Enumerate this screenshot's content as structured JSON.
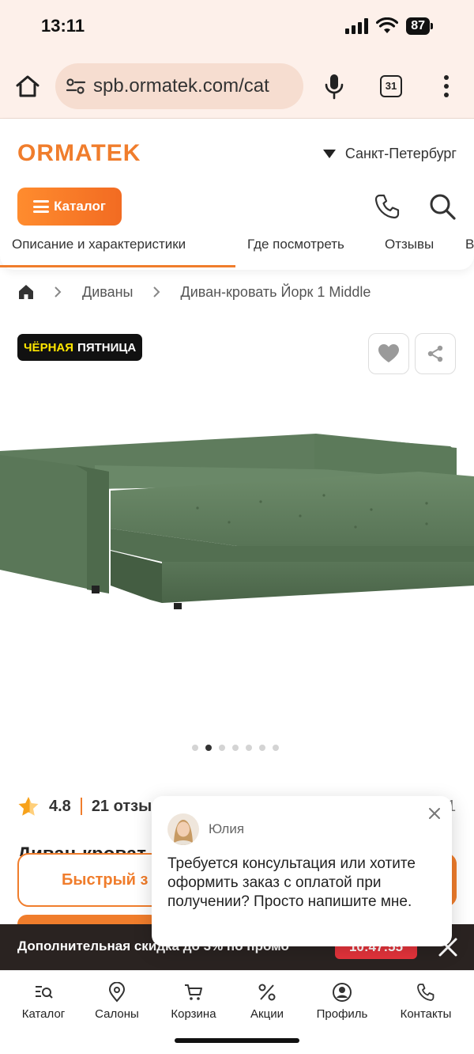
{
  "status_bar": {
    "time": "13:11",
    "battery": "87"
  },
  "browser": {
    "url": "spb.ormatek.com/cat",
    "tab_count": "31"
  },
  "header": {
    "logo": "ORMATEK",
    "city": "Санкт-Петербург",
    "catalog_label": "Каталог",
    "tabs": [
      {
        "label": "Описание и характеристики",
        "active": true
      },
      {
        "label": "Где посмотреть"
      },
      {
        "label": "Отзывы"
      },
      {
        "label": "В"
      }
    ]
  },
  "breadcrumb": {
    "items": [
      "Диваны",
      "Диван-кровать Йорк 1 Middle"
    ]
  },
  "badge": {
    "part1": "ЧЁРНАЯ",
    "part2": "ПЯТНИЦА"
  },
  "carousel": {
    "count": 7,
    "active": 1
  },
  "rating": {
    "value": "4.8",
    "reviews": "21 отзы",
    "extra": "1"
  },
  "product": {
    "title_peek": "Диван-кроват",
    "quick_buy_label": "Быстрый з"
  },
  "promo": {
    "text": "Дополнительная скидка до 3% по промо",
    "timer": "10:47:55"
  },
  "chat": {
    "name": "Юлия",
    "message": "Требуется консультация или хотите оформить заказ с оплатой при получении? Просто напишите мне."
  },
  "bottom_nav": [
    {
      "label": "Каталог",
      "icon": "catalog-search-icon"
    },
    {
      "label": "Салоны",
      "icon": "location-pin-icon"
    },
    {
      "label": "Корзина",
      "icon": "cart-icon"
    },
    {
      "label": "Акции",
      "icon": "percent-icon"
    },
    {
      "label": "Профиль",
      "icon": "profile-icon"
    },
    {
      "label": "Контакты",
      "icon": "phone-icon"
    }
  ],
  "colors": {
    "brand": "#f07d2c",
    "promo_bg": "#2a2321",
    "timer": "#e6343c",
    "badge_yellow": "#ffe600"
  }
}
